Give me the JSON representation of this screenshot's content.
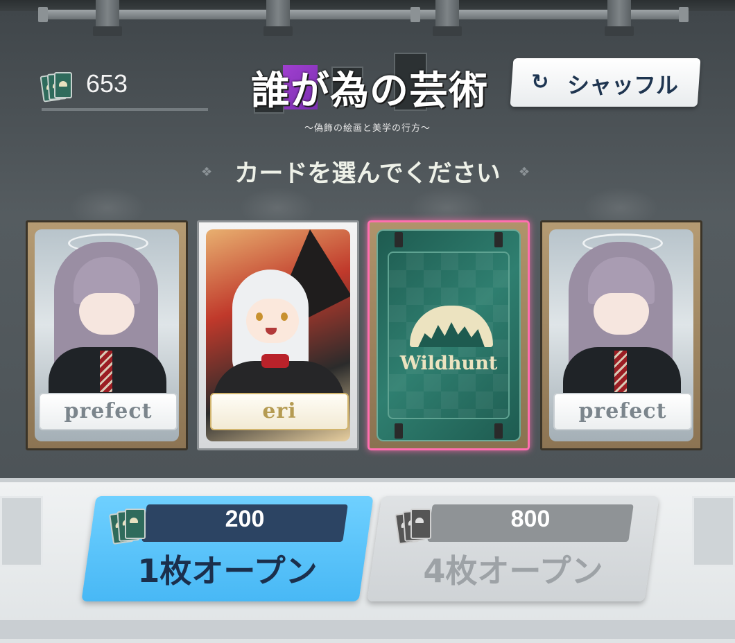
{
  "currency": {
    "icon": "card-stack-icon",
    "value": "653"
  },
  "logo": {
    "title": "誰が為の芸術",
    "subtitle": "〜偽飾の絵画と美学の行方〜"
  },
  "shuffle": {
    "icon": "rotate-icon",
    "label": "シャッフル"
  },
  "prompt": "カードを選んでください",
  "cards": [
    {
      "name": "prefect",
      "frame": "gold",
      "state": "revealed"
    },
    {
      "name": "eri",
      "frame": "silver",
      "state": "revealed"
    },
    {
      "name": "Wildhunt",
      "frame": "card-back",
      "state": "hidden",
      "highlight": "#ff6fb0"
    },
    {
      "name": "prefect",
      "frame": "gold",
      "state": "revealed"
    }
  ],
  "open_one": {
    "cost": "200",
    "label": "1枚オープン",
    "enabled": true,
    "color": "#48b8f5"
  },
  "open_four": {
    "cost": "800",
    "label": "4枚オープン",
    "enabled": false,
    "color": "#cfd3d6"
  }
}
